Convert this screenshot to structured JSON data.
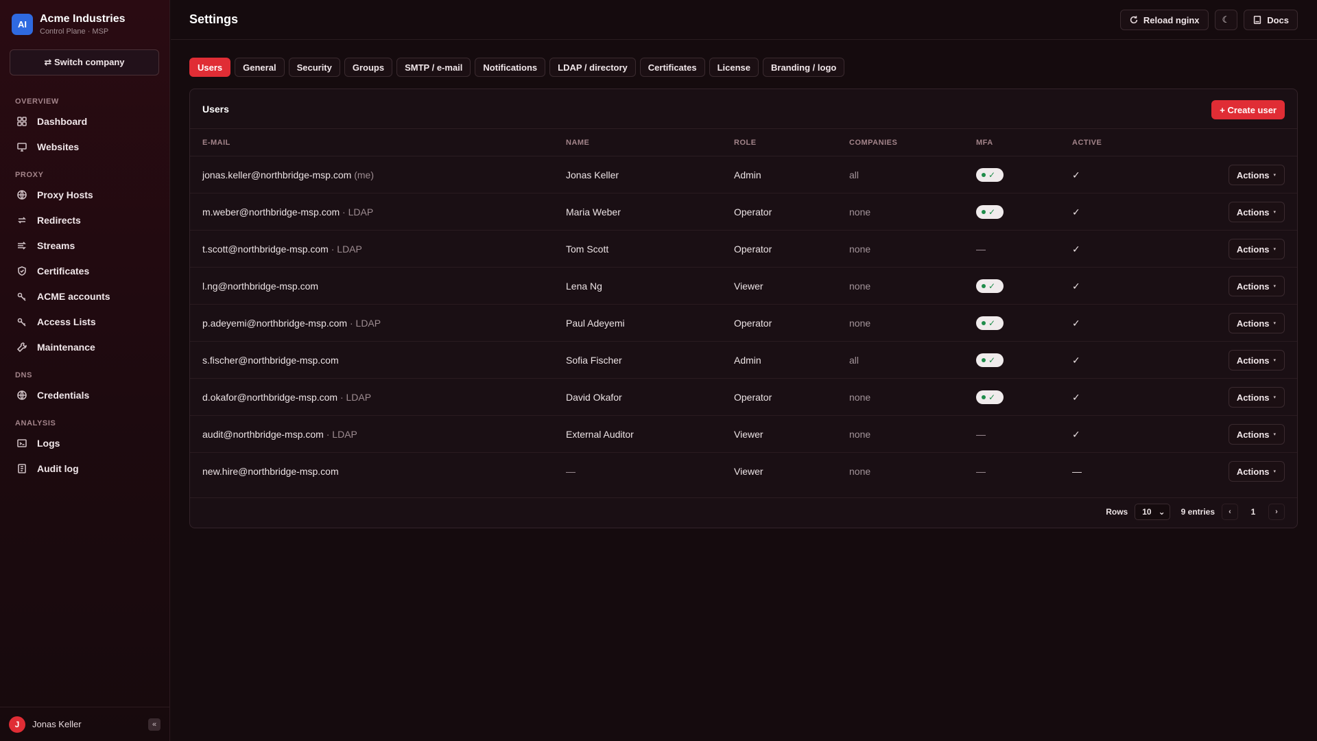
{
  "brand": {
    "logo": "AI",
    "name": "Acme Industries",
    "subtitle": "Control Plane · MSP"
  },
  "switch_company": "⇄ Switch company",
  "sidebar": {
    "sections": [
      {
        "label": "OVERVIEW",
        "items": [
          {
            "label": "Dashboard",
            "icon": "grid-icon"
          },
          {
            "label": "Websites",
            "icon": "monitor-icon"
          }
        ]
      },
      {
        "label": "PROXY",
        "items": [
          {
            "label": "Proxy Hosts",
            "icon": "globe-icon"
          },
          {
            "label": "Redirects",
            "icon": "redirect-icon"
          },
          {
            "label": "Streams",
            "icon": "streams-icon"
          },
          {
            "label": "Certificates",
            "icon": "shield-icon"
          },
          {
            "label": "ACME accounts",
            "icon": "key-icon"
          },
          {
            "label": "Access Lists",
            "icon": "key-icon"
          },
          {
            "label": "Maintenance",
            "icon": "wrench-icon"
          }
        ]
      },
      {
        "label": "DNS",
        "items": [
          {
            "label": "Credentials",
            "icon": "globe-icon"
          }
        ]
      },
      {
        "label": "ANALYSIS",
        "items": [
          {
            "label": "Logs",
            "icon": "terminal-icon"
          },
          {
            "label": "Audit log",
            "icon": "clipboard-icon"
          }
        ]
      }
    ]
  },
  "footer": {
    "avatar": "J",
    "user": "Jonas Keller",
    "collapse": "«"
  },
  "header": {
    "title": "Settings",
    "reload": "Reload nginx",
    "theme_icon": "☾",
    "docs": "Docs"
  },
  "tabs": [
    "Users",
    "General",
    "Security",
    "Groups",
    "SMTP / e-mail",
    "Notifications",
    "LDAP / directory",
    "Certificates",
    "License",
    "Branding / logo"
  ],
  "active_tab": 0,
  "card": {
    "title": "Users",
    "create": "+ Create user"
  },
  "columns": [
    "E-MAIL",
    "NAME",
    "ROLE",
    "COMPANIES",
    "MFA",
    "ACTIVE"
  ],
  "users": [
    {
      "email": "jonas.keller@northbridge-msp.com",
      "suffix": " (me)",
      "name": "Jonas Keller",
      "role": "Admin",
      "companies": "all",
      "mfa": true,
      "active": "✓"
    },
    {
      "email": "m.weber@northbridge-msp.com",
      "suffix": " · LDAP",
      "name": "Maria Weber",
      "role": "Operator",
      "companies": "none",
      "mfa": true,
      "active": "✓"
    },
    {
      "email": "t.scott@northbridge-msp.com",
      "suffix": " · LDAP",
      "name": "Tom Scott",
      "role": "Operator",
      "companies": "none",
      "mfa": false,
      "active": "✓"
    },
    {
      "email": "l.ng@northbridge-msp.com",
      "suffix": "",
      "name": "Lena Ng",
      "role": "Viewer",
      "companies": "none",
      "mfa": true,
      "active": "✓"
    },
    {
      "email": "p.adeyemi@northbridge-msp.com",
      "suffix": " · LDAP",
      "name": "Paul Adeyemi",
      "role": "Operator",
      "companies": "none",
      "mfa": true,
      "active": "✓"
    },
    {
      "email": "s.fischer@northbridge-msp.com",
      "suffix": "",
      "name": "Sofia Fischer",
      "role": "Admin",
      "companies": "all",
      "mfa": true,
      "active": "✓"
    },
    {
      "email": "d.okafor@northbridge-msp.com",
      "suffix": " · LDAP",
      "name": "David Okafor",
      "role": "Operator",
      "companies": "none",
      "mfa": true,
      "active": "✓"
    },
    {
      "email": "audit@northbridge-msp.com",
      "suffix": " · LDAP",
      "name": "External Auditor",
      "role": "Viewer",
      "companies": "none",
      "mfa": false,
      "active": "✓"
    },
    {
      "email": "new.hire@northbridge-msp.com",
      "suffix": "",
      "name": "—",
      "role": "Viewer",
      "companies": "none",
      "mfa": false,
      "active": "—"
    }
  ],
  "mfa_off": "—",
  "mfa_check": "✓",
  "actions_label": "Actions",
  "actions_caret": "▾",
  "pager": {
    "rows_label": "Rows",
    "rows_value": "10",
    "rows_caret": "⌄",
    "entries": "9 entries",
    "prev": "‹",
    "page": "1",
    "next": "›"
  },
  "colors": {
    "accent": "#e02d35",
    "brand_logo": "#2f6ae0",
    "mfa_on": "#1f8c4a"
  }
}
